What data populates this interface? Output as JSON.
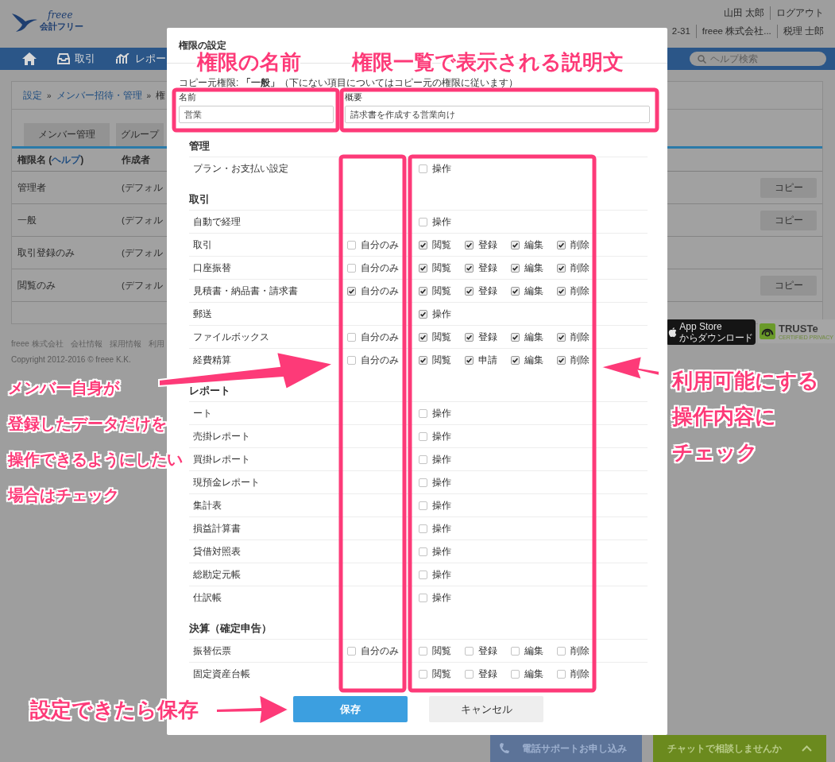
{
  "header": {
    "logo_text": "freee",
    "app_name": "会計フリー",
    "user_links": [
      "山田 太郎",
      "ログアウト"
    ],
    "account_links": [
      "2-31",
      "freee 株式会社...",
      "税理 士郎"
    ]
  },
  "nav": {
    "items": [
      {
        "kind": "tray",
        "label": "取引"
      },
      {
        "kind": "chart",
        "label": "レポー"
      }
    ],
    "search": {
      "placeholder": "ヘルプ検索"
    }
  },
  "breadcrumb": [
    {
      "kind": "link",
      "label": "設定"
    },
    {
      "kind": "separator",
      "label": "»"
    },
    {
      "kind": "link",
      "label": "メンバー招待・管理"
    },
    {
      "kind": "separator",
      "label": "»"
    },
    {
      "kind": "text",
      "label": "権"
    }
  ],
  "tabs": [
    {
      "label": "メンバー管理",
      "selected": false
    },
    {
      "label": "グループ",
      "selected": false
    }
  ],
  "table": {
    "columns": [
      {
        "parts": [
          {
            "kind": "text",
            "text": "権限名 ("
          },
          {
            "kind": "link",
            "text": "ヘルプ"
          },
          {
            "kind": "text",
            "text": ")"
          }
        ]
      },
      {
        "parts": [
          {
            "kind": "text",
            "text": "作成者"
          }
        ]
      }
    ],
    "rows": [
      {
        "name": "管理者",
        "creator": "(デフォル",
        "action": "コピー"
      },
      {
        "name": "一般",
        "creator": "(デフォル",
        "action": "コピー"
      },
      {
        "name": "取引登録のみ",
        "creator": "(デフォル"
      },
      {
        "name": "閲覧のみ",
        "creator": "(デフォル",
        "action": "コピー"
      }
    ]
  },
  "footer": {
    "links": [
      "freee 株式会社",
      "会社情報",
      "採用情報",
      "利用"
    ],
    "copyright": "Copyright 2012-2016 © freee K.K.",
    "app_store": {
      "title": "App Store",
      "subtitle": "からダウンロード"
    },
    "truste": {
      "title": "TRUSTe",
      "subtitle": "CERTIFIED PRIVACY"
    }
  },
  "support": {
    "phone": "電話サポートお申し込み",
    "chat": "チャットで相談しませんか"
  },
  "modal": {
    "title": "権限の設定",
    "note": "コピー元権限: **「一般」**（下にない項目についてはコピー元の権限に従います）",
    "fields": [
      {
        "label": "名前",
        "value": "営業"
      },
      {
        "label": "概要",
        "value": "請求書を作成する営業向け"
      }
    ],
    "sections": [
      {
        "title": "管理",
        "rows": [
          {
            "label": "プラン・お支払い設定",
            "ops": [
              {
                "label": "操作",
                "checked": false
              }
            ]
          }
        ]
      },
      {
        "title": "取引",
        "rows": [
          {
            "label": "自動で経理",
            "ops": [
              {
                "label": "操作",
                "checked": false
              }
            ]
          },
          {
            "label": "取引",
            "self_only": {
              "label": "自分のみ",
              "checked": false
            },
            "ops": [
              {
                "label": "閲覧",
                "checked": true
              },
              {
                "label": "登録",
                "checked": true
              },
              {
                "label": "編集",
                "checked": true
              },
              {
                "label": "削除",
                "checked": true
              }
            ]
          },
          {
            "label": "口座振替",
            "self_only": {
              "label": "自分のみ",
              "checked": false
            },
            "ops": [
              {
                "label": "閲覧",
                "checked": true
              },
              {
                "label": "登録",
                "checked": true
              },
              {
                "label": "編集",
                "checked": true
              },
              {
                "label": "削除",
                "checked": true
              }
            ]
          },
          {
            "label": "見積書・納品書・請求書",
            "self_only": {
              "label": "自分のみ",
              "checked": true
            },
            "ops": [
              {
                "label": "閲覧",
                "checked": true
              },
              {
                "label": "登録",
                "checked": true
              },
              {
                "label": "編集",
                "checked": true
              },
              {
                "label": "削除",
                "checked": true
              }
            ]
          },
          {
            "label": "郵送",
            "ops": [
              {
                "label": "操作",
                "checked": true
              }
            ]
          },
          {
            "label": "ファイルボックス",
            "self_only": {
              "label": "自分のみ",
              "checked": false
            },
            "ops": [
              {
                "label": "閲覧",
                "checked": true
              },
              {
                "label": "登録",
                "checked": true
              },
              {
                "label": "編集",
                "checked": true
              },
              {
                "label": "削除",
                "checked": true
              }
            ]
          },
          {
            "label": "経費精算",
            "self_only": {
              "label": "自分のみ",
              "checked": false
            },
            "ops": [
              {
                "label": "閲覧",
                "checked": true
              },
              {
                "label": "申請",
                "checked": true
              },
              {
                "label": "編集",
                "checked": true
              },
              {
                "label": "削除",
                "checked": true
              }
            ]
          }
        ]
      },
      {
        "title": "レポート",
        "rows": [
          {
            "label": "ート",
            "ops": [
              {
                "label": "操作",
                "checked": false
              }
            ]
          },
          {
            "label": "売掛レポート",
            "ops": [
              {
                "label": "操作",
                "checked": false
              }
            ]
          },
          {
            "label": "買掛レポート",
            "ops": [
              {
                "label": "操作",
                "checked": false
              }
            ]
          },
          {
            "label": "現預金レポート",
            "ops": [
              {
                "label": "操作",
                "checked": false
              }
            ]
          },
          {
            "label": "集計表",
            "ops": [
              {
                "label": "操作",
                "checked": false
              }
            ]
          },
          {
            "label": "損益計算書",
            "ops": [
              {
                "label": "操作",
                "checked": false
              }
            ]
          },
          {
            "label": "貸借対照表",
            "ops": [
              {
                "label": "操作",
                "checked": false
              }
            ]
          },
          {
            "label": "総勘定元帳",
            "ops": [
              {
                "label": "操作",
                "checked": false
              }
            ]
          },
          {
            "label": "仕訳帳",
            "ops": [
              {
                "label": "操作",
                "checked": false
              }
            ]
          }
        ]
      },
      {
        "title": "決算（確定申告）",
        "rows": [
          {
            "label": "振替伝票",
            "self_only": {
              "label": "自分のみ",
              "checked": false
            },
            "ops": [
              {
                "label": "閲覧",
                "checked": false
              },
              {
                "label": "登録",
                "checked": false
              },
              {
                "label": "編集",
                "checked": false
              },
              {
                "label": "削除",
                "checked": false
              }
            ]
          },
          {
            "label": "固定資産台帳",
            "ops": [
              {
                "label": "閲覧",
                "checked": false
              },
              {
                "label": "登録",
                "checked": false
              },
              {
                "label": "編集",
                "checked": false
              },
              {
                "label": "削除",
                "checked": false
              }
            ]
          }
        ]
      }
    ],
    "buttons": [
      {
        "kind": "primary",
        "label": "保存"
      },
      {
        "kind": "secondary",
        "label": "キャンセル"
      }
    ]
  },
  "annotations": {
    "name_label": "権限の名前",
    "description_label": "権限一覧で表示される説明文",
    "self_only_note": [
      "メンバー自身が",
      "登録したデータだけを",
      "操作できるようにしたい",
      "場合はチェック"
    ],
    "operations_note": [
      "利用可能にする",
      "操作内容に",
      "チェック"
    ],
    "save_note": "設定できたら保存"
  }
}
